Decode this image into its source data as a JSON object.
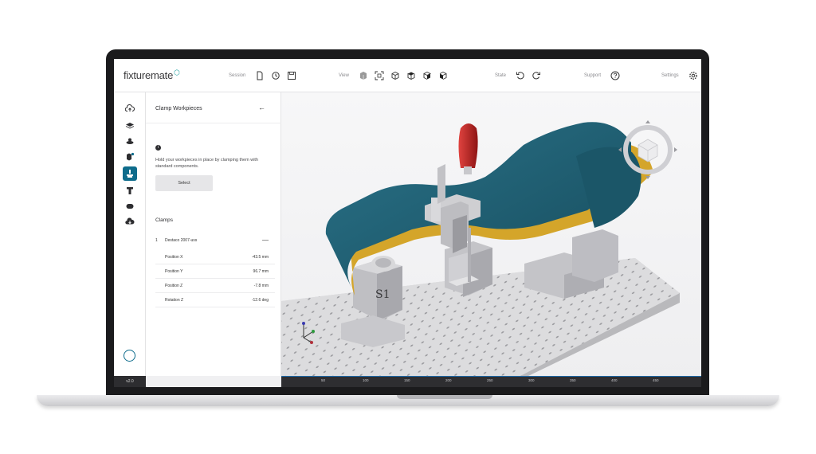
{
  "app": {
    "logo_text": "fixture",
    "logo_text_2": "mate",
    "version": "v2.0"
  },
  "toolbar": {
    "session_label": "Session",
    "view_label": "View",
    "state_label": "State",
    "support_label": "Support",
    "settings_label": "Settings",
    "session_icons": [
      "new-file-icon",
      "history-icon",
      "save-icon"
    ],
    "view_icons": [
      "solid-view-icon",
      "fit-view-icon",
      "iso-view-1-icon",
      "iso-view-2-icon",
      "iso-view-3-icon",
      "iso-view-4-icon"
    ],
    "state_icons": [
      "undo-icon",
      "redo-icon"
    ]
  },
  "rail": {
    "items": [
      "upload-icon",
      "layers-icon",
      "workpiece-icon",
      "add-part-icon",
      "clamp-icon",
      "fixture-icon",
      "component-icon",
      "export-icon"
    ],
    "active_index": 4
  },
  "panel": {
    "title": "Clamp Workpieces",
    "description": "Hold your workpieces in place by clamping them with standard components.",
    "select_label": "Select",
    "clamps_heading": "Clamps",
    "clamp": {
      "index": "1",
      "name": "Destaco 2007-uss",
      "properties": [
        {
          "key": "Position X",
          "value": "-43.5 mm"
        },
        {
          "key": "Position Y",
          "value": "96.7 mm"
        },
        {
          "key": "Position Z",
          "value": "-7.8 mm"
        },
        {
          "key": "Rotation Z",
          "value": "-12.6 deg"
        }
      ]
    }
  },
  "viewport": {
    "ruler_ticks": [
      "50",
      "100",
      "150",
      "200",
      "250",
      "300",
      "350",
      "400",
      "450"
    ],
    "part_color": "#1d5b6e",
    "accent_color": "#d4a52a",
    "handle_color": "#b81f1f",
    "plate_color": "#d8d8da",
    "ruler_line_color": "#1d67a5",
    "marking_text": "S1"
  }
}
